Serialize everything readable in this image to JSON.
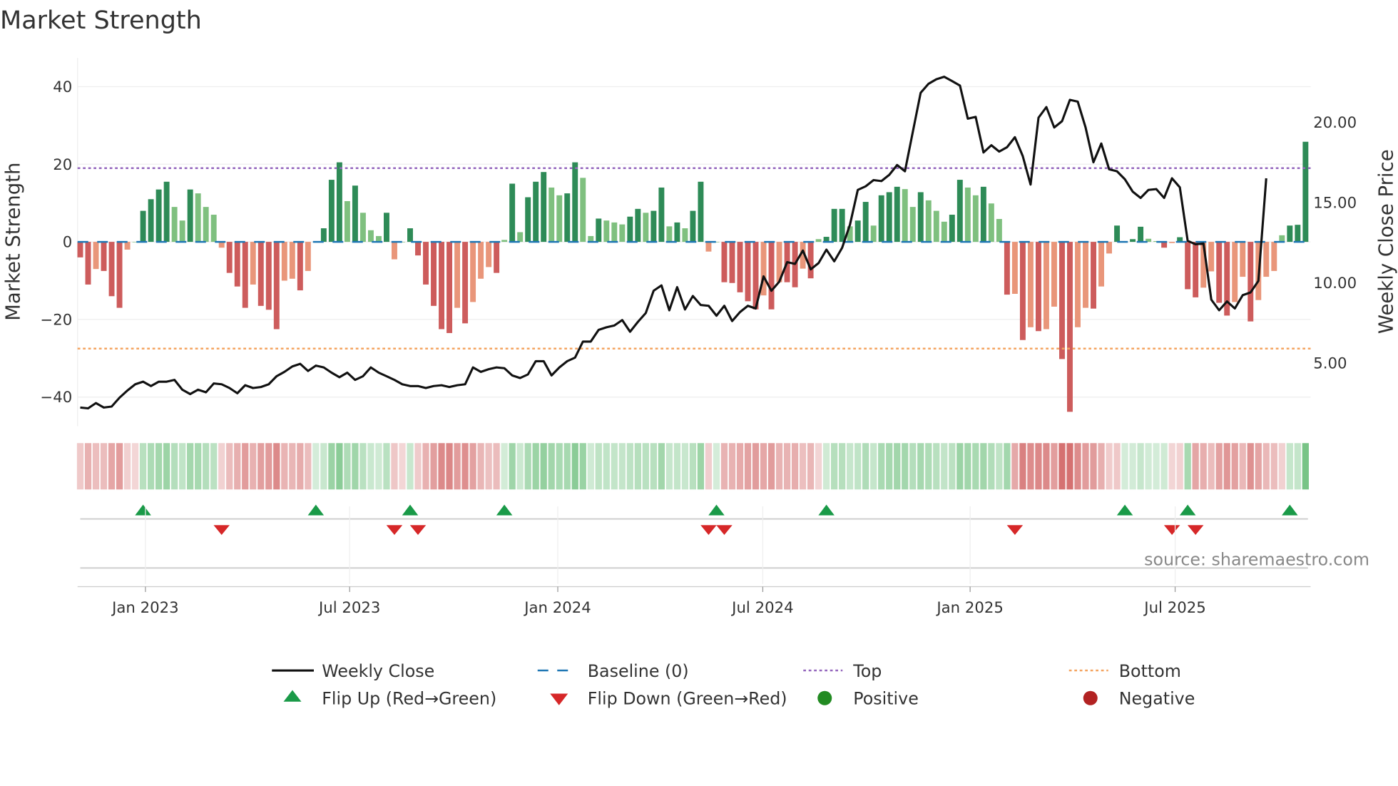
{
  "chart_data": {
    "type": "bar",
    "title": "Market Strength",
    "ylabel": "Market Strength",
    "y2label": "Weekly Close Price",
    "ylim": [
      -47.5,
      47.4
    ],
    "y2lim": [
      1.06,
      24.0
    ],
    "yticks": [
      "40",
      "20",
      "0",
      "−20",
      "−40"
    ],
    "ytick_values": [
      40,
      20,
      0,
      -20,
      -40
    ],
    "y2ticks": [
      "20.00",
      "15.00",
      "10.00",
      "5.00"
    ],
    "y2tick_values": [
      20,
      15,
      10,
      5
    ],
    "xticks": [
      {
        "label": "Jan 2023",
        "week": 8.3
      },
      {
        "label": "Jul 2023",
        "week": 34.3
      },
      {
        "label": "Jan 2024",
        "week": 60.8
      },
      {
        "label": "Jul 2024",
        "week": 86.9
      },
      {
        "label": "Jan 2025",
        "week": 113.3
      },
      {
        "label": "Jul 2025",
        "week": 139.4
      }
    ],
    "top_level": 19,
    "bottom_level": -27.5,
    "baseline": 0,
    "strength": [
      -4,
      -11,
      -7,
      -7.5,
      -14,
      -17,
      -2,
      0,
      8,
      11,
      13.5,
      15.5,
      9,
      5.5,
      13.5,
      12.5,
      9,
      7,
      -1.5,
      -8,
      -11.5,
      -17,
      -11,
      -16.5,
      -17.5,
      -22.5,
      -10,
      -9.5,
      -12.5,
      -7.5,
      0,
      3.5,
      16,
      20.5,
      10.5,
      14.5,
      7.5,
      3,
      1.5,
      7.5,
      -4.5,
      0,
      3.5,
      -3.5,
      -11,
      -16.5,
      -22.5,
      -23.5,
      -17,
      -21,
      -15.5,
      -9.5,
      -6.5,
      -8,
      0.5,
      15,
      2.5,
      11.5,
      15.5,
      18,
      14,
      12,
      12.5,
      20.5,
      16.5,
      1.5,
      6,
      5.5,
      5,
      4.5,
      6.5,
      8.5,
      7.5,
      8,
      14,
      4,
      5,
      3.5,
      8,
      15.5,
      -2.5,
      0,
      -10.4,
      -10.6,
      -13,
      -15.3,
      -17.4,
      -13.8,
      -17.4,
      -10.4,
      -10.4,
      -11.7,
      -6.9,
      -9.4,
      0.7,
      1.3,
      8.5,
      8.5,
      4,
      5.5,
      10.3,
      4.2,
      12,
      12.8,
      14.2,
      13.6,
      9,
      12.8,
      10.7,
      8,
      5.2,
      7,
      16,
      14,
      12,
      14.2,
      9.9,
      5.9,
      -13.6,
      -13.4,
      -25.3,
      -22,
      -23,
      -22.5,
      -16.7,
      -30.2,
      -43.8,
      -22,
      -17,
      -17.2,
      -11.5,
      -3,
      4.2,
      0,
      0.7,
      3.9,
      0.8,
      0.2,
      -1.5,
      -0.3,
      1.2,
      -12.2,
      -14.3,
      -11.8,
      -7.6,
      -15.7,
      -19,
      -15.5,
      -9,
      -20.5,
      -15,
      -9,
      -7.5,
      1.7,
      4.2,
      4.4,
      25.8
    ],
    "weekly_close": [
      2.22,
      2.17,
      2.5,
      2.22,
      2.28,
      2.83,
      3.28,
      3.67,
      3.83,
      3.56,
      3.83,
      3.83,
      3.94,
      3.33,
      3.06,
      3.33,
      3.17,
      3.72,
      3.67,
      3.44,
      3.11,
      3.61,
      3.44,
      3.5,
      3.67,
      4.17,
      4.44,
      4.78,
      4.94,
      4.5,
      4.83,
      4.72,
      4.39,
      4.11,
      4.39,
      3.94,
      4.17,
      4.72,
      4.39,
      4.17,
      3.94,
      3.67,
      3.56,
      3.56,
      3.44,
      3.56,
      3.61,
      3.5,
      3.61,
      3.67,
      4.72,
      4.44,
      4.61,
      4.72,
      4.67,
      4.22,
      4.06,
      4.28,
      5.11,
      5.11,
      4.22,
      4.72,
      5.11,
      5.33,
      6.33,
      6.33,
      7.06,
      7.22,
      7.33,
      7.67,
      6.94,
      7.56,
      8.11,
      9.5,
      9.83,
      8.28,
      9.72,
      8.33,
      9.17,
      8.61,
      8.56,
      7.94,
      8.56,
      7.61,
      8.17,
      8.56,
      8.39,
      10.39,
      9.5,
      10.06,
      11.28,
      11.17,
      12.0,
      10.83,
      11.22,
      12.06,
      11.33,
      12.17,
      13.61,
      15.78,
      16.0,
      16.39,
      16.33,
      16.72,
      17.33,
      16.94,
      19.39,
      21.83,
      22.39,
      22.67,
      22.83,
      22.56,
      22.28,
      20.22,
      20.33,
      18.11,
      18.56,
      18.17,
      18.44,
      19.06,
      17.89,
      16.11,
      20.28,
      20.94,
      19.67,
      20.06,
      21.39,
      21.28,
      19.67,
      17.5,
      18.67,
      17.06,
      16.94,
      16.44,
      15.67,
      15.28,
      15.78,
      15.83,
      15.28,
      16.5,
      15.94,
      12.61,
      12.39,
      12.44,
      8.94,
      8.28,
      8.83,
      8.39,
      9.22,
      9.39,
      10.11,
      16.5
    ],
    "flip_up_weeks": [
      8,
      30,
      42,
      54,
      81,
      95,
      133,
      141,
      154
    ],
    "flip_down_weeks": [
      18,
      40,
      43,
      80,
      82,
      119,
      139,
      142
    ],
    "legend": [
      {
        "label": "Weekly Close"
      },
      {
        "label": "Baseline (0)"
      },
      {
        "label": "Top"
      },
      {
        "label": "Bottom"
      },
      {
        "label": "Flip Up (Red→Green)"
      },
      {
        "label": "Flip Down (Green→Red)"
      },
      {
        "label": "Positive"
      },
      {
        "label": "Negative"
      }
    ],
    "legend_position": "bottom-center",
    "source": "source: sharemaestro.com",
    "colors": {
      "pos_dark": "#2e8b57",
      "pos_light": "#7fc07f",
      "neg_dark": "#cd5c5c",
      "neg_light": "#e9967a",
      "baseline": "#1f77b4",
      "top": "#9467bd",
      "bottom": "#f4a460",
      "flip_up": "#1a9a48",
      "flip_down": "#d62728",
      "positive": "#228b22",
      "negative": "#b22222",
      "line": "#111111"
    }
  }
}
